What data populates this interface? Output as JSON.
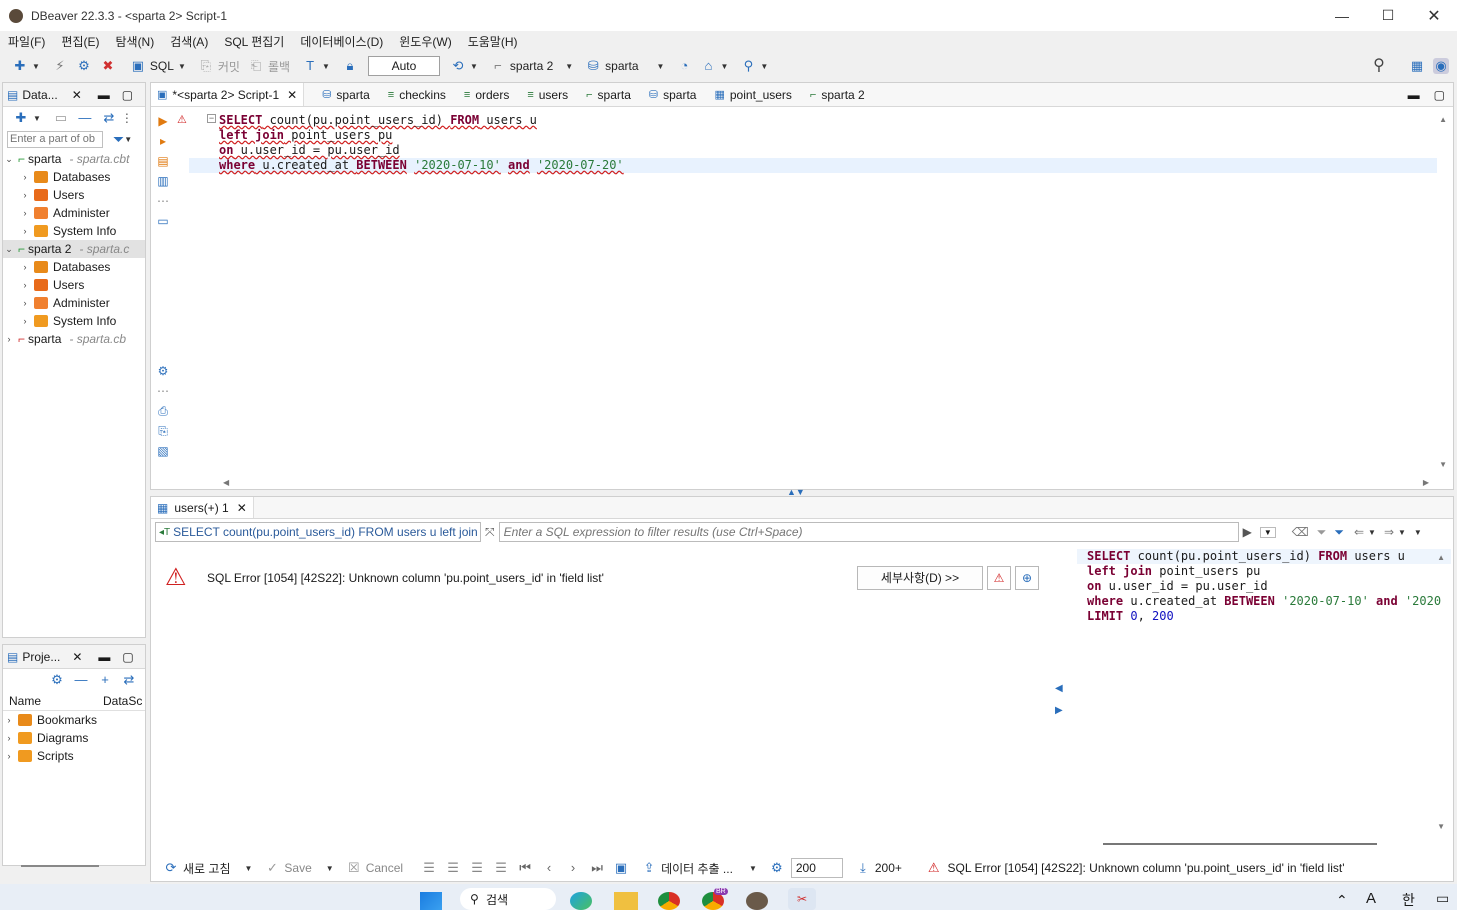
{
  "window": {
    "title": "DBeaver 22.3.3 - <sparta 2> Script-1"
  },
  "menu": [
    "파일(F)",
    "편집(E)",
    "탐색(N)",
    "검색(A)",
    "SQL 편집기",
    "데이터베이스(D)",
    "윈도우(W)",
    "도움말(H)"
  ],
  "toolbar": {
    "sql_label": "SQL",
    "commit_label": "커밋",
    "rollback_label": "롤백",
    "mode_value": "Auto",
    "datasource_label": "sparta 2",
    "schema_label": "sparta"
  },
  "db_nav": {
    "tab_label": "Data...",
    "search_placeholder": "Enter a part of ob",
    "connections": [
      {
        "name": "sparta",
        "host": "- sparta.cbt",
        "children": [
          "Databases",
          "Users",
          "Administer",
          "System Info"
        ]
      },
      {
        "name": "sparta 2",
        "host": "- sparta.c",
        "children": [
          "Databases",
          "Users",
          "Administer",
          "System Info"
        ]
      },
      {
        "name": "sparta",
        "host": "- sparta.cb",
        "children": []
      }
    ]
  },
  "projects": {
    "tab_label": "Proje...",
    "col_name": "Name",
    "col_datasource": "DataSc",
    "items": [
      "Bookmarks",
      "Diagrams",
      "Scripts"
    ]
  },
  "editor_tabs": [
    {
      "label": "*<sparta 2> Script-1",
      "icon": "script-icon"
    },
    {
      "label": "sparta",
      "icon": "database-icon"
    },
    {
      "label": "checkins",
      "icon": "table-icon"
    },
    {
      "label": "orders",
      "icon": "table-icon"
    },
    {
      "label": "users",
      "icon": "table-icon"
    },
    {
      "label": "sparta",
      "icon": "connection-icon"
    },
    {
      "label": "sparta",
      "icon": "database-icon"
    },
    {
      "label": "point_users",
      "icon": "table-grid-icon"
    },
    {
      "label": "sparta 2",
      "icon": "connection-icon"
    }
  ],
  "sql": {
    "line1_kw1": "SELECT",
    "line1_rest": " count(pu.point_users_id) ",
    "line1_kw2": "FROM",
    "line1_tail": " users u",
    "line2_kw1": "left join",
    "line2_rest": " point_users pu",
    "line3_kw": "on",
    "line3_rest": " u.user_id = pu.user_id",
    "line4_kw": "where",
    "line4_rest": " u.created_at ",
    "line4_kw2": "BETWEEN",
    "line4_str1": "'2020-07-10'",
    "line4_kw3": "and",
    "line4_str2": "'2020-07-20'"
  },
  "results": {
    "tab_label": "users(+) 1",
    "query_label": "SELECT count(pu.point_users_id) FROM users u left join",
    "filter_placeholder": "Enter a SQL expression to filter results (use Ctrl+Space)",
    "error_message": "SQL Error [1054] [42S22]: Unknown column 'pu.point_users_id' in 'field list'",
    "details_button": "세부사항(D) >>",
    "side_sql": {
      "l1a": "SELECT",
      "l1b": " count(pu.point_users_id) ",
      "l1c": "FROM",
      "l1d": " users u",
      "l2a": "left join",
      "l2b": " point_users pu",
      "l3a": "on",
      "l3b": " u.user_id = pu.user_id",
      "l4a": "where",
      "l4b": " u.created_at ",
      "l4c": "BETWEEN",
      "l4d": "'2020-07-10'",
      "l4e": "and",
      "l4f": "'2020",
      "l5a": "LIMIT",
      "l5b": "0",
      "l5c": "200"
    }
  },
  "bottombar": {
    "refresh_label": "새로 고침",
    "save_label": "Save",
    "cancel_label": "Cancel",
    "export_label": "데이터 추출 ...",
    "fetch_size": "200",
    "fetch_more": "200+",
    "status_error": "SQL Error [1054] [42S22]: Unknown column 'pu.point_users_id' in 'field list'"
  },
  "taskbar": {
    "search_label": "검색",
    "lang_label": "한",
    "badge": "BR"
  }
}
